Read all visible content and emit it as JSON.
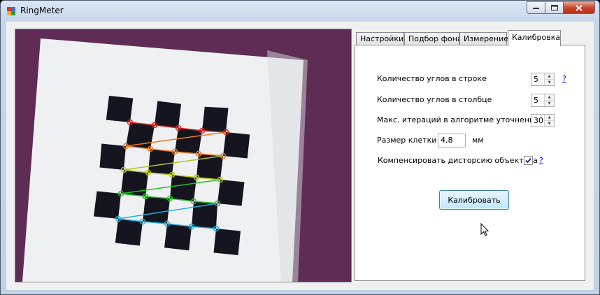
{
  "window": {
    "title": "RingMeter"
  },
  "tabs": [
    {
      "label": "Настройки",
      "active": false
    },
    {
      "label": "Подбор фона",
      "active": false
    },
    {
      "label": "Измерение",
      "active": false
    },
    {
      "label": "Калибровка",
      "active": true
    }
  ],
  "calibration": {
    "corners_row_label": "Количество углов в строке",
    "corners_row_value": "5",
    "corners_col_label": "Количество углов в столбце",
    "corners_col_value": "5",
    "max_iter_label": "Макс. итераций в алгоритме уточнения",
    "max_iter_value": "30",
    "cell_size_label": "Размер клетки",
    "cell_size_value": "4,8",
    "cell_size_unit": "мм",
    "distortion_label": "Компенсировать дисторсию объектива",
    "distortion_checked": true,
    "help_symbol": "?",
    "calibrate_button": "Калибровать"
  },
  "colors": {
    "background_purple": "#5e2c55",
    "paper": "#eef0f2",
    "square": "#15151f",
    "row_colors": [
      "#e02020",
      "#f07818",
      "#b8c41c",
      "#22c222",
      "#22b0d8"
    ]
  }
}
